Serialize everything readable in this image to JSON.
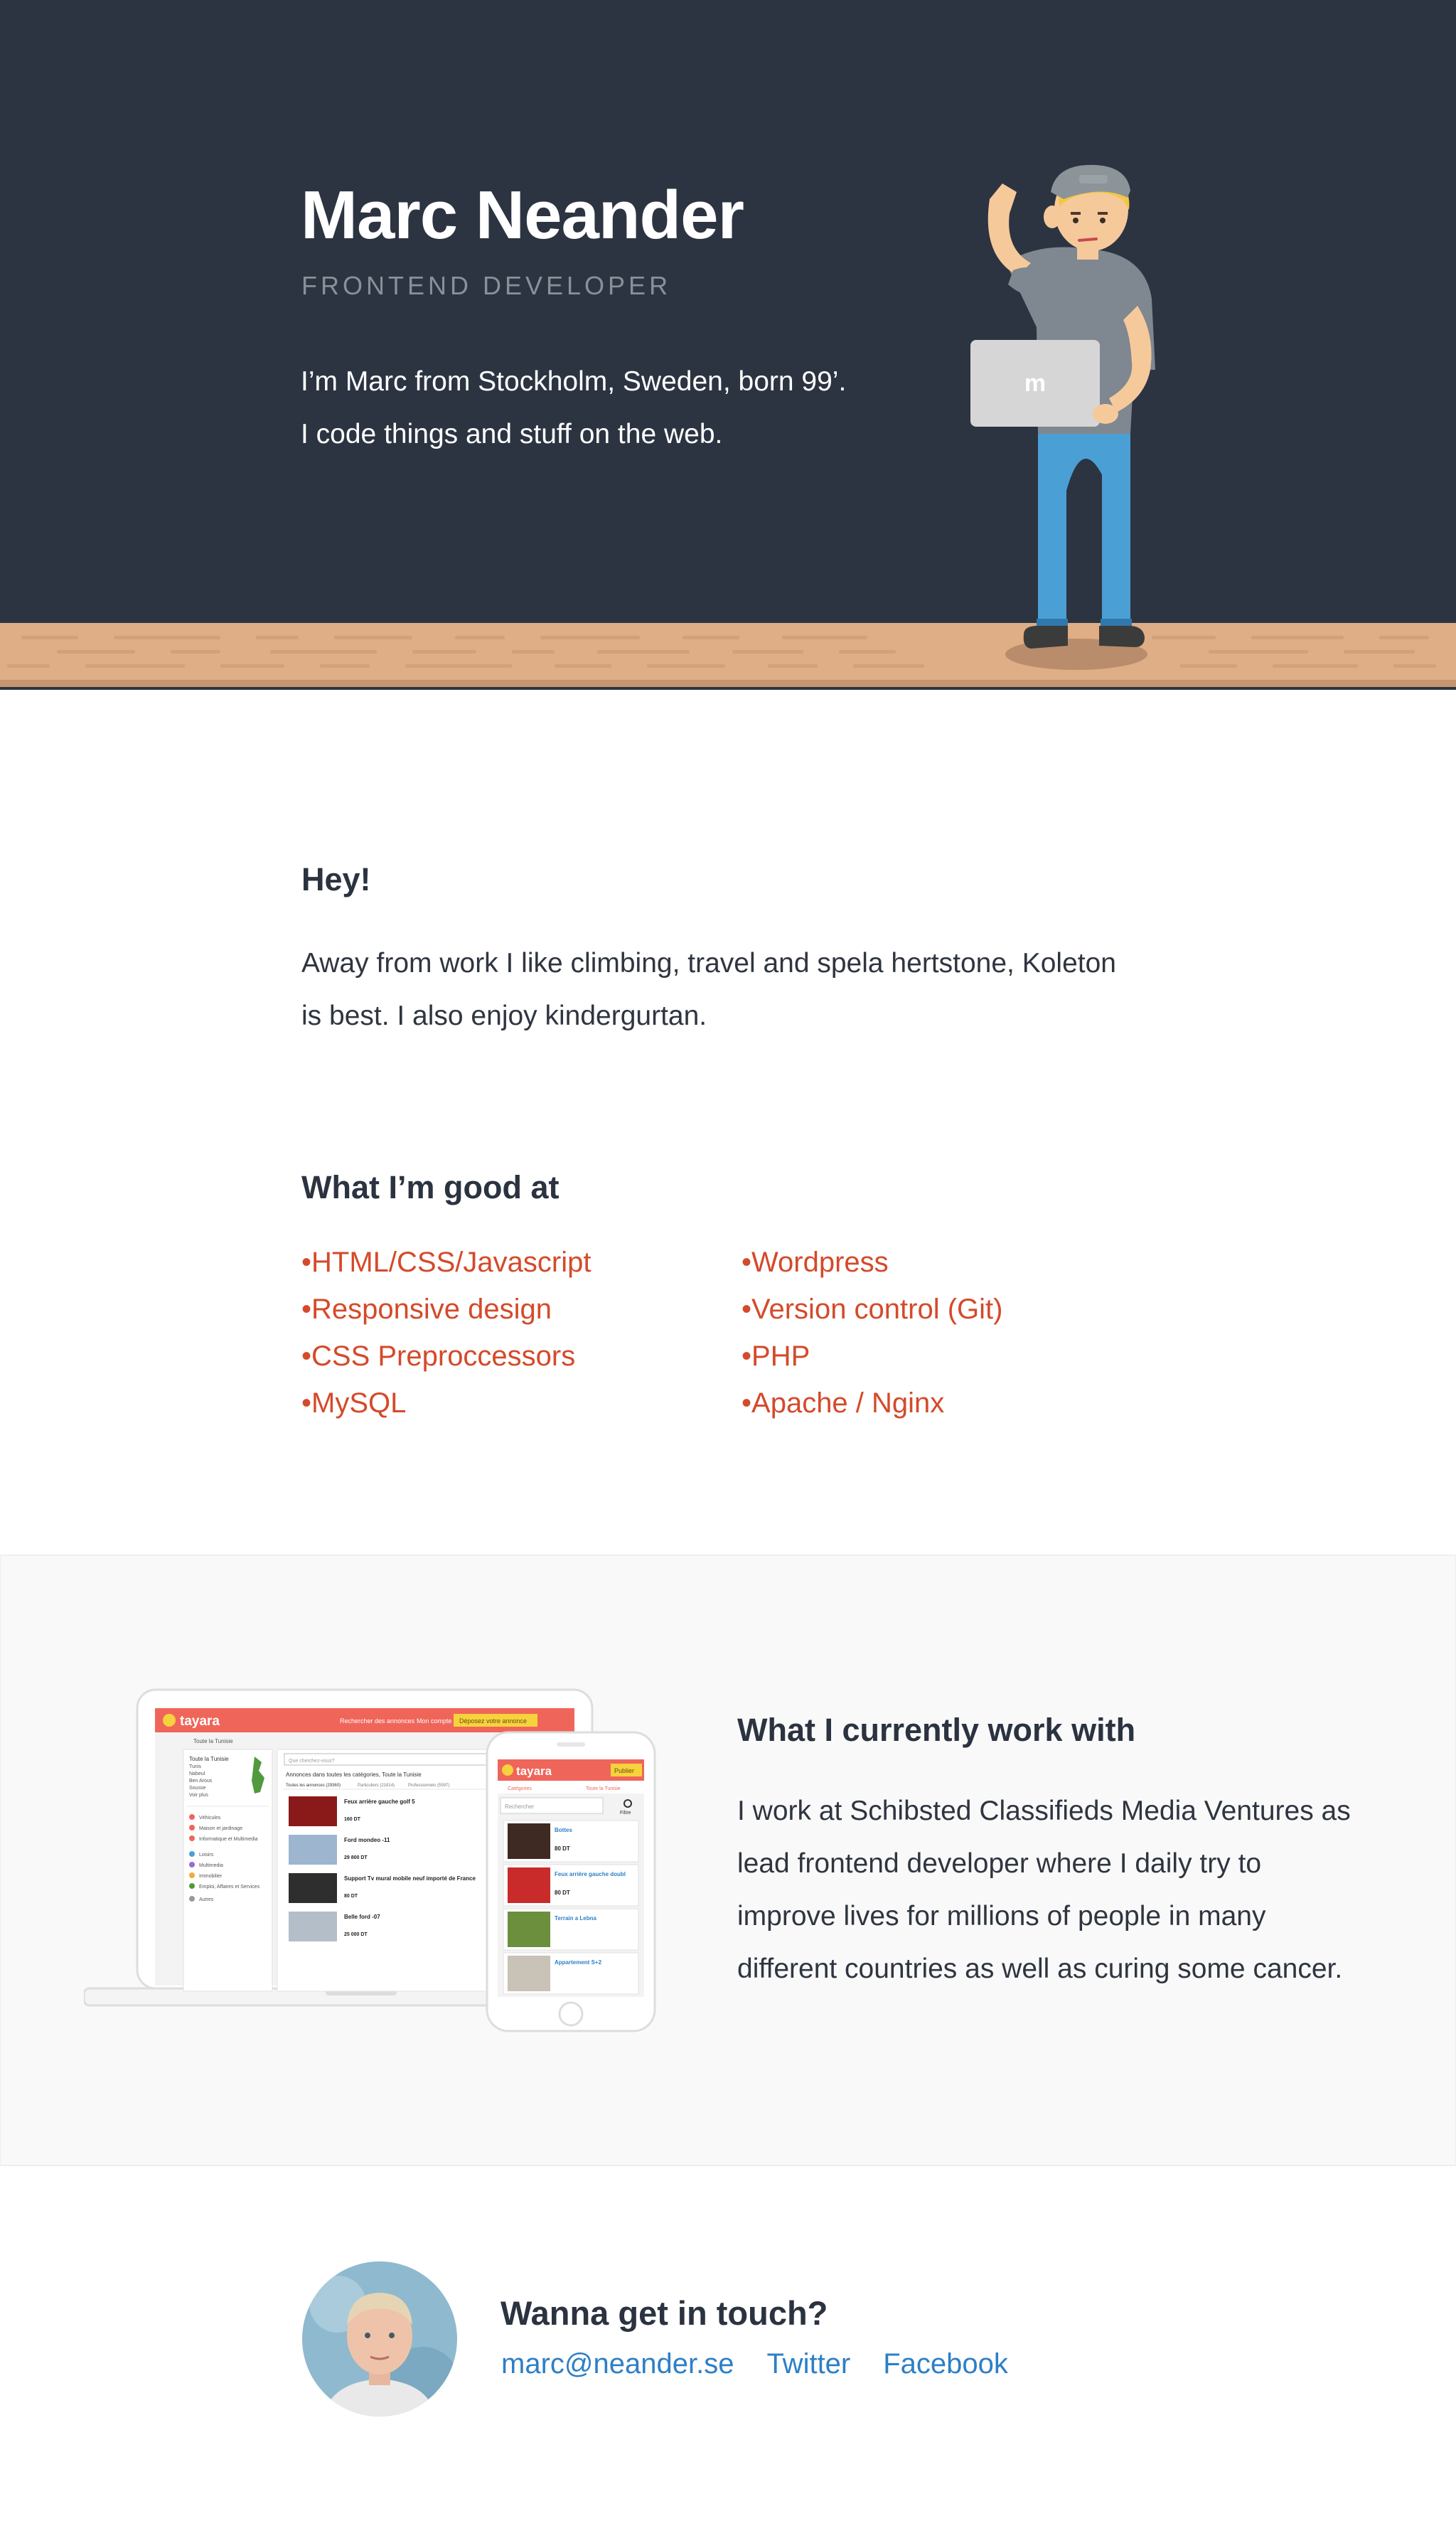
{
  "hero": {
    "name": "Marc Neander",
    "role": "FRONTEND DEVELOPER",
    "intro_line1": "I’m Marc from Stockholm, Sweden, born 99’.",
    "intro_line2": "I code things and stuff on the web.",
    "laptop_logo": "m"
  },
  "about": {
    "title": "Hey!",
    "text_line1": "Away from work I like climbing, travel and spela hertstone, Koleton",
    "text_line2": "is best. I also enjoy kindergurtan."
  },
  "skills": {
    "title": "What I’m good at",
    "left": [
      "HTML/CSS/Javascript",
      "Responsive design",
      "CSS Preproccessors",
      "MySQL"
    ],
    "right": [
      "Wordpress",
      "Version control (Git)",
      "PHP",
      "Apache / Nginx"
    ]
  },
  "work": {
    "title": "What I currently work with",
    "lines": [
      "I work at Schibsted Classifieds Media Ventures as",
      "lead frontend developer where I daily try to",
      "improve lives for millions of people in many",
      "different countries as well as curing some cancer."
    ],
    "mockup": {
      "brand": "tayara",
      "nav_search": "Rechercher des annonces",
      "nav_account": "Mon compte",
      "nav_cta": "Déposez votre annonce",
      "search_placeholder": "Que cherchez-vous?",
      "breadcrumb": "Toute la Tunisie",
      "listing_heading": "Annonces dans toutes les catégories, Toute la Tunisie",
      "tab_all": "Toutes les annonces (29360)",
      "tab_private": "Particuliers (21814)",
      "tab_pro": "Professionnels (5597)",
      "regions": [
        "Toute la Tunisie",
        "Tunis",
        "Nabeul",
        "Ben Arous",
        "Sousse",
        "Voir plus"
      ],
      "categories": [
        "Véhicules",
        "Maison et jardinage",
        "Informatique et Multimedia",
        "Loisirs",
        "Multimedia",
        "Immobilier",
        "Emploi, Affaires et Services",
        "Autres"
      ],
      "listings": [
        {
          "title": "Feux arrière gauche golf 5",
          "price": "160 DT"
        },
        {
          "title": "Ford mondeo -11",
          "price": "29 800 DT"
        },
        {
          "title": "Support Tv mural mobile neuf importé de France",
          "price": "80 DT"
        },
        {
          "title": "Belle ford -07",
          "price": "25 000 DT"
        }
      ],
      "phone": {
        "brand": "tayara",
        "publish": "Publier",
        "tab_categories": "Catégories",
        "tab_region": "Toute la Tunisie",
        "search_placeholder": "Rechercher",
        "filter": "Filtre",
        "listings": [
          {
            "title": "Bottes",
            "price": "80 DT"
          },
          {
            "title": "Feux arrière gauche doubl",
            "price": "80 DT"
          },
          {
            "title": "Terrain a Lebna",
            "price": ""
          },
          {
            "title": "Appartement S+2",
            "price": ""
          }
        ]
      }
    }
  },
  "contact": {
    "title": "Wanna get in touch?",
    "email": "marc@neander.se",
    "twitter": "Twitter",
    "facebook": "Facebook"
  },
  "colors": {
    "hero_bg": "#2c3441",
    "ground": "#dfae86",
    "skills_text": "#d44a2a",
    "link": "#2d7fc6",
    "tayara_red": "#f0655a",
    "tayara_yellow": "#f6d33c"
  }
}
